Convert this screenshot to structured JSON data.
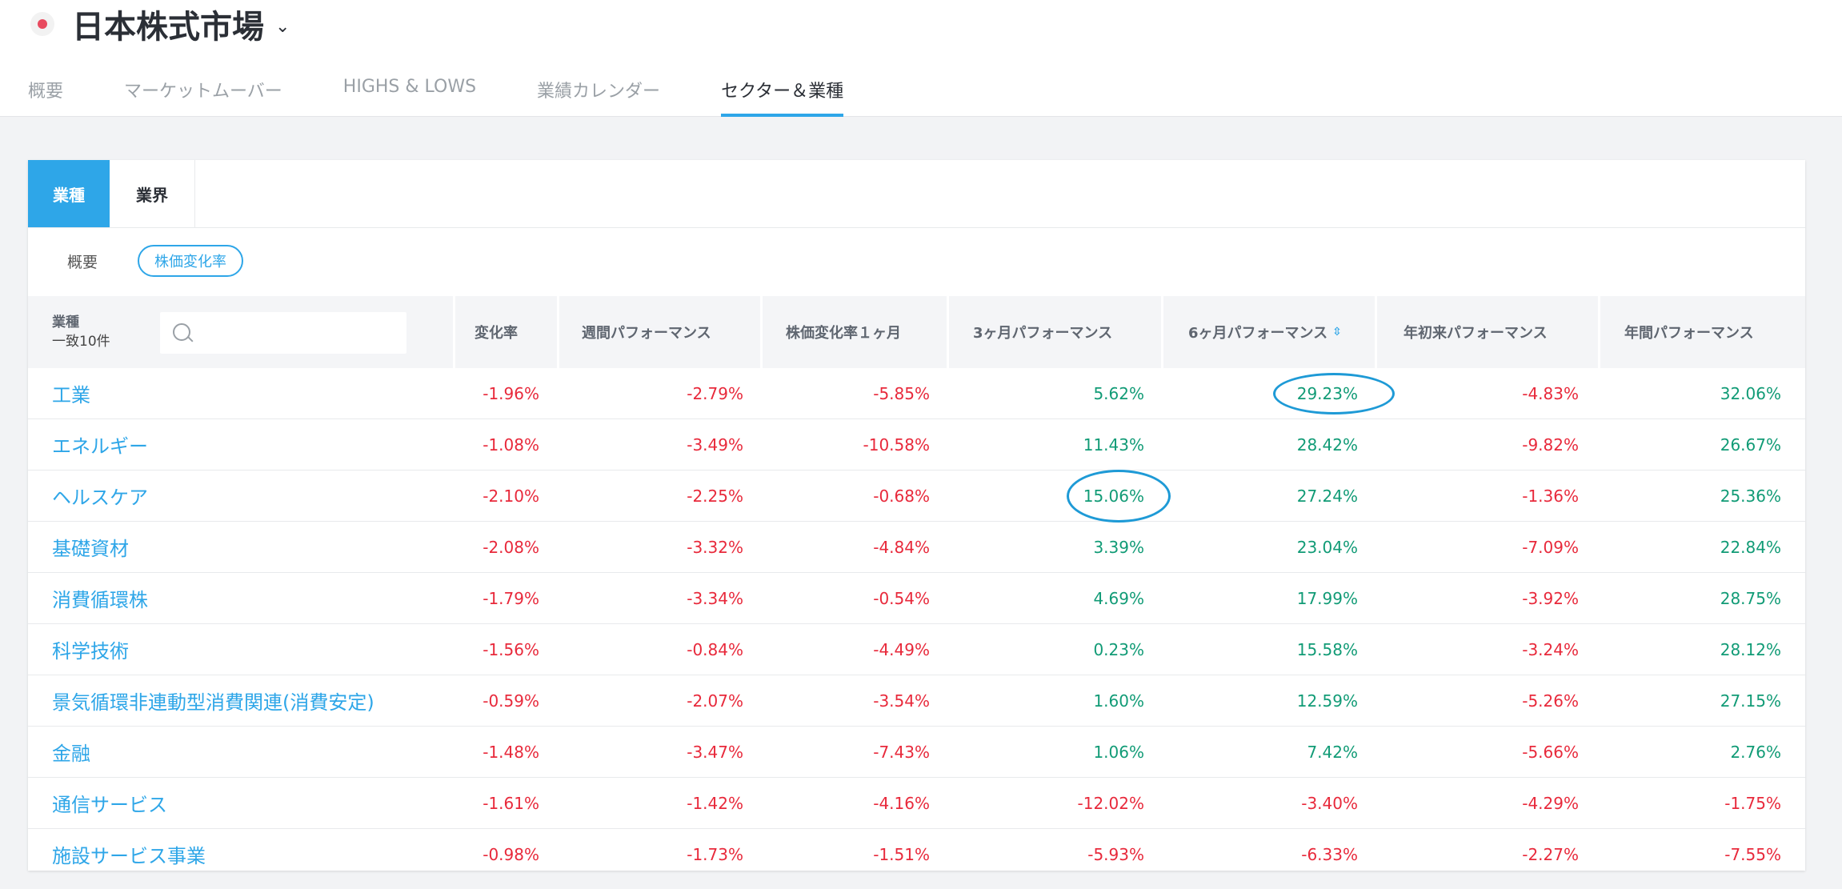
{
  "header": {
    "title": "日本株式市場"
  },
  "nav": {
    "tabs": [
      "概要",
      "マーケットムーバー",
      "HIGHS & LOWS",
      "業績カレンダー",
      "セクター＆業種"
    ],
    "active": "セクター＆業種"
  },
  "segments": {
    "industry": "業種",
    "sector": "業界"
  },
  "subtabs": {
    "overview": "概要",
    "price_change": "株価変化率"
  },
  "table": {
    "industry_header": "業種",
    "match_count": "一致10件",
    "search_placeholder": "",
    "columns": [
      "変化率",
      "週間パフォーマンス",
      "株価変化率１ヶ月",
      "3ヶ月パフォーマンス",
      "6ヶ月パフォーマンス",
      "年初来パフォーマンス",
      "年間パフォーマンス"
    ],
    "rows": [
      {
        "name": "工業",
        "values": [
          "-1.96%",
          "-2.79%",
          "-5.85%",
          "5.62%",
          "29.23%",
          "-4.83%",
          "32.06%"
        ]
      },
      {
        "name": "エネルギー",
        "values": [
          "-1.08%",
          "-3.49%",
          "-10.58%",
          "11.43%",
          "28.42%",
          "-9.82%",
          "26.67%"
        ]
      },
      {
        "name": "ヘルスケア",
        "values": [
          "-2.10%",
          "-2.25%",
          "-0.68%",
          "15.06%",
          "27.24%",
          "-1.36%",
          "25.36%"
        ]
      },
      {
        "name": "基礎資材",
        "values": [
          "-2.08%",
          "-3.32%",
          "-4.84%",
          "3.39%",
          "23.04%",
          "-7.09%",
          "22.84%"
        ]
      },
      {
        "name": "消費循環株",
        "values": [
          "-1.79%",
          "-3.34%",
          "-0.54%",
          "4.69%",
          "17.99%",
          "-3.92%",
          "28.75%"
        ]
      },
      {
        "name": "科学技術",
        "values": [
          "-1.56%",
          "-0.84%",
          "-4.49%",
          "0.23%",
          "15.58%",
          "-3.24%",
          "28.12%"
        ]
      },
      {
        "name": "景気循環非連動型消費関連(消費安定)",
        "values": [
          "-0.59%",
          "-2.07%",
          "-3.54%",
          "1.60%",
          "12.59%",
          "-5.26%",
          "27.15%"
        ]
      },
      {
        "name": "金融",
        "values": [
          "-1.48%",
          "-3.47%",
          "-7.43%",
          "1.06%",
          "7.42%",
          "-5.66%",
          "2.76%"
        ]
      },
      {
        "name": "通信サービス",
        "values": [
          "-1.61%",
          "-1.42%",
          "-4.16%",
          "-12.02%",
          "-3.40%",
          "-4.29%",
          "-1.75%"
        ]
      },
      {
        "name": "施設サービス事業",
        "values": [
          "-0.98%",
          "-1.73%",
          "-1.51%",
          "-5.93%",
          "-6.33%",
          "-2.27%",
          "-7.55%"
        ]
      }
    ]
  },
  "colors": {
    "accent": "#2ea6e8",
    "negative": "#e8293b",
    "positive": "#119b76",
    "annotation": "#1e9ad6"
  }
}
